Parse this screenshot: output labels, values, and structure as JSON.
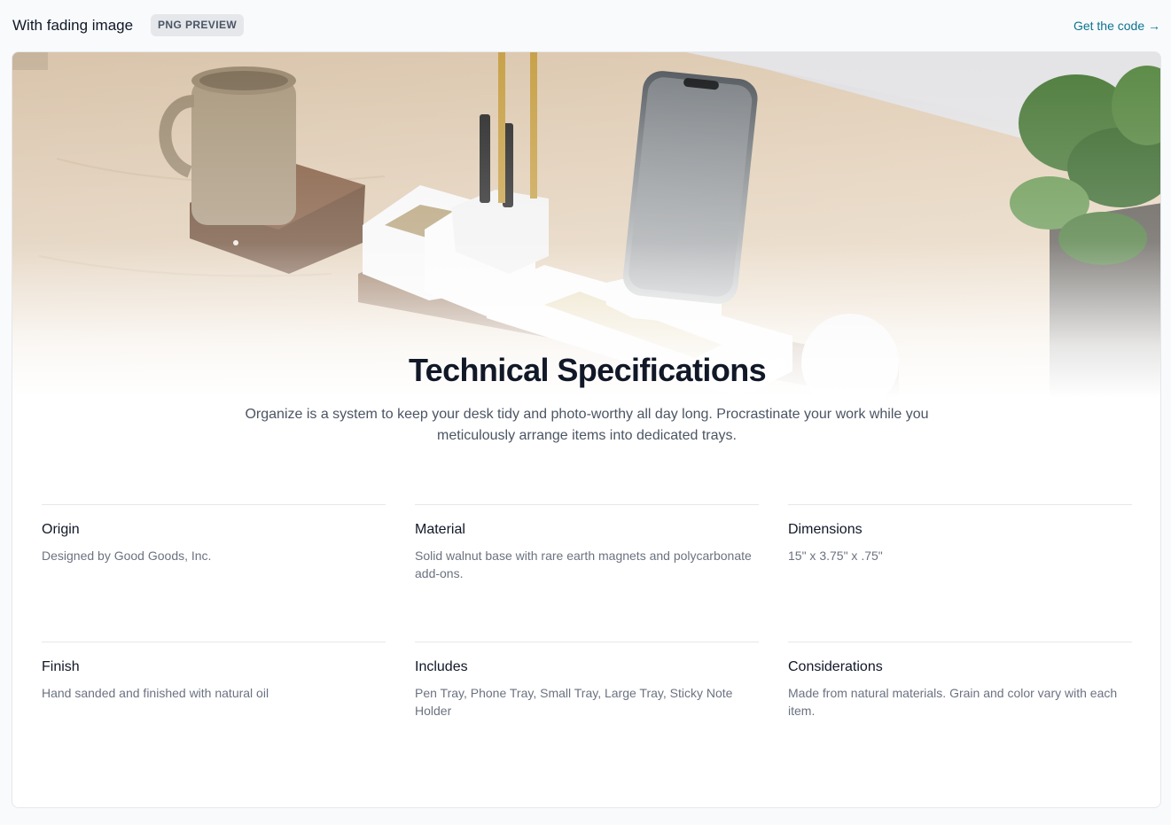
{
  "header": {
    "title": "With fading image",
    "badge": "PNG PREVIEW",
    "link": "Get the code →"
  },
  "hero": {
    "image_alt": "Walnut desk organizer with mug, pens, phone and plant"
  },
  "section": {
    "heading": "Technical Specifications",
    "description": "Organize is a system to keep your desk tidy and photo-worthy all day long. Procrastinate your work while you meticulously arrange items into dedicated trays."
  },
  "specs": [
    {
      "term": "Origin",
      "desc": "Designed by Good Goods, Inc."
    },
    {
      "term": "Material",
      "desc": "Solid walnut base with rare earth magnets and polycarbonate add-ons."
    },
    {
      "term": "Dimensions",
      "desc": "15\" x 3.75\" x .75\""
    },
    {
      "term": "Finish",
      "desc": "Hand sanded and finished with natural oil"
    },
    {
      "term": "Includes",
      "desc": "Pen Tray, Phone Tray, Small Tray, Large Tray, Sticky Note Holder"
    },
    {
      "term": "Considerations",
      "desc": "Made from natural materials. Grain and color vary with each item."
    }
  ],
  "colors": {
    "link": "#0e7490",
    "heading": "#111827",
    "muted": "#6b7280",
    "badge_bg": "#e5e7eb"
  }
}
